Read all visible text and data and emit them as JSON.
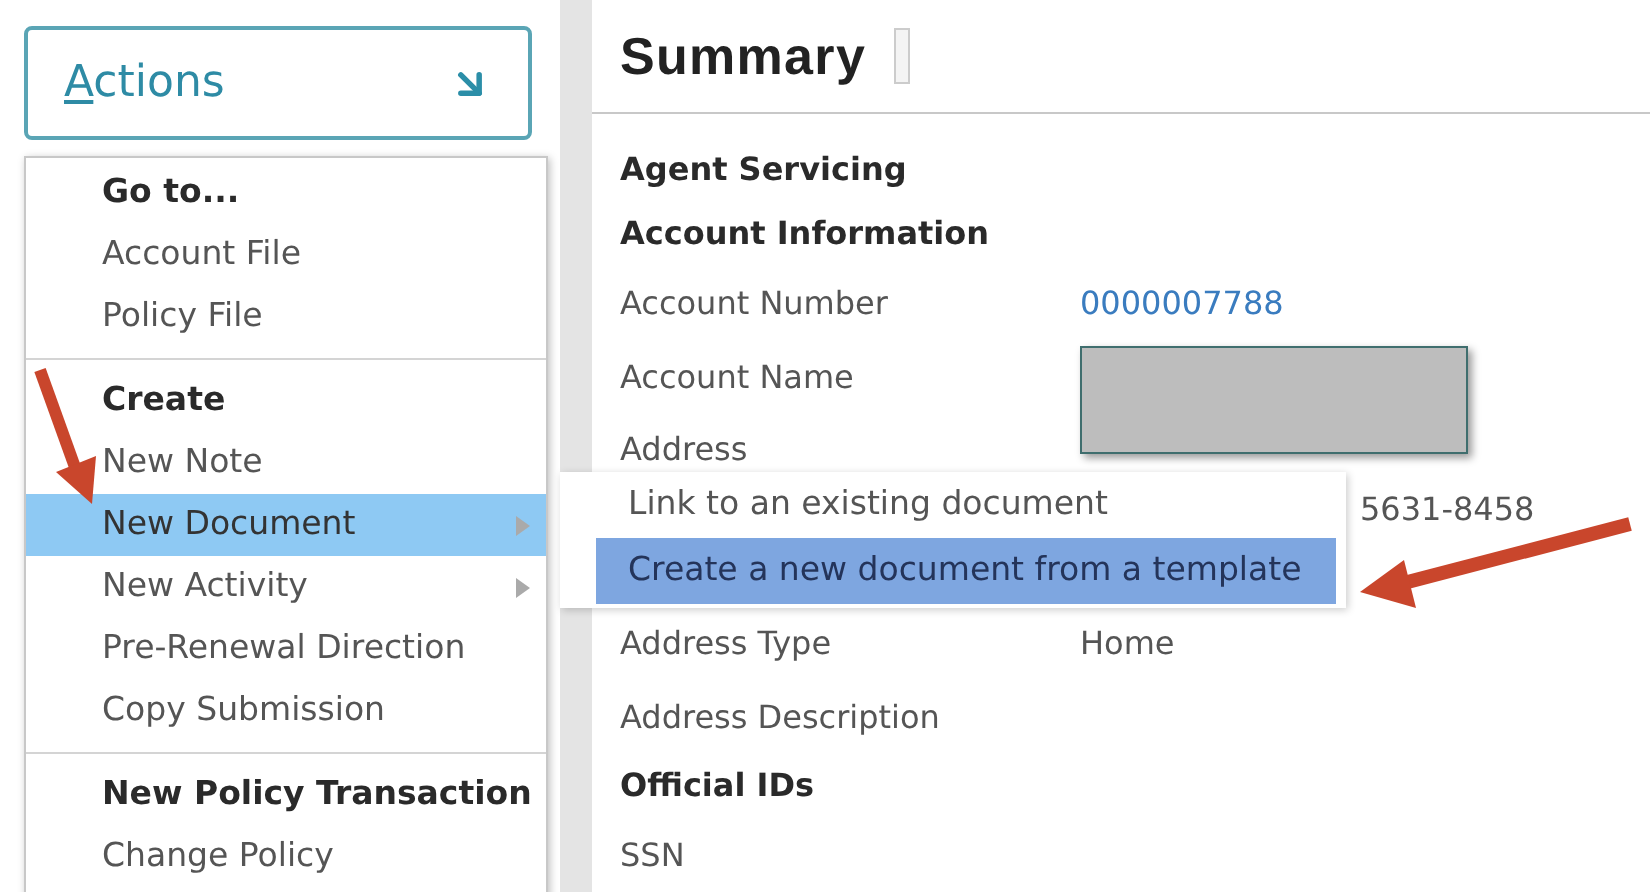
{
  "actions_button": {
    "label": "Actions"
  },
  "actions_menu": [
    {
      "kind": "heading",
      "label": "Go to..."
    },
    {
      "kind": "item",
      "label": "Account File",
      "selected": false,
      "submenu": false
    },
    {
      "kind": "item",
      "label": "Policy File",
      "selected": false,
      "submenu": false
    },
    {
      "kind": "divider"
    },
    {
      "kind": "heading",
      "label": "Create"
    },
    {
      "kind": "item",
      "label": "New Note",
      "selected": false,
      "submenu": false
    },
    {
      "kind": "item",
      "label": "New Document",
      "selected": true,
      "submenu": true
    },
    {
      "kind": "item",
      "label": "New Activity",
      "selected": false,
      "submenu": true
    },
    {
      "kind": "item",
      "label": "Pre-Renewal Direction",
      "selected": false,
      "submenu": false
    },
    {
      "kind": "item",
      "label": "Copy Submission",
      "selected": false,
      "submenu": false
    },
    {
      "kind": "divider"
    },
    {
      "kind": "heading",
      "label": "New Policy Transaction"
    },
    {
      "kind": "item",
      "label": "Change Policy",
      "selected": false,
      "submenu": false
    }
  ],
  "submenu": [
    {
      "label": "Link to an existing document",
      "selected": false
    },
    {
      "label": "Create a new document from a template",
      "selected": true
    }
  ],
  "summary": {
    "title": "Summary",
    "rows": [
      {
        "kind": "heading",
        "label": "Agent Servicing"
      },
      {
        "kind": "heading",
        "label": "Account Information"
      },
      {
        "kind": "field",
        "label": "Account Number",
        "value": "0000007788",
        "link": true
      },
      {
        "kind": "field",
        "label": "Account Name",
        "redacted": true
      },
      {
        "kind": "address",
        "label": "Address",
        "value_continued": "5631-8458"
      },
      {
        "kind": "field",
        "label": "Address Type",
        "value": "Home",
        "link": false
      },
      {
        "kind": "field",
        "label": "Address Description"
      },
      {
        "kind": "heading",
        "label": "Official IDs"
      },
      {
        "kind": "field",
        "label": "SSN"
      }
    ]
  }
}
